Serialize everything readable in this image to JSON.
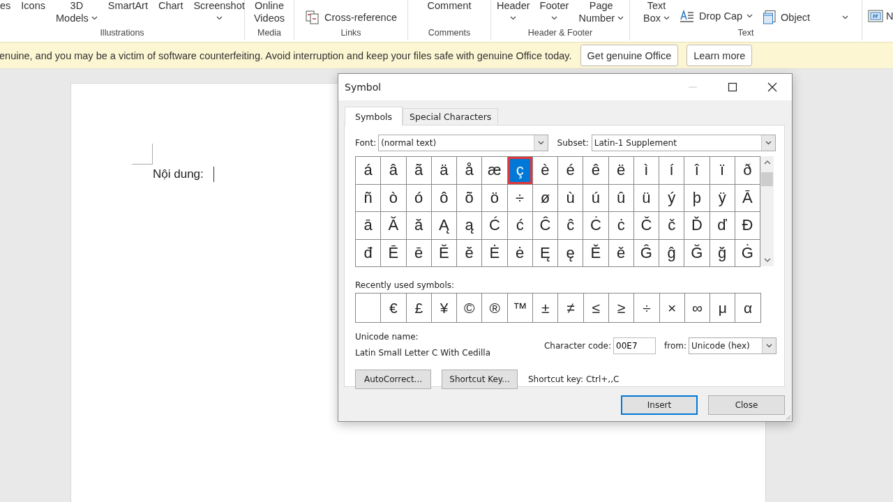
{
  "ribbon": {
    "groups": [
      {
        "label": "Illustrations",
        "items": [
          {
            "kind": "big",
            "lines": [
              "es"
            ],
            "dropdown": false
          },
          {
            "kind": "big",
            "lines": [
              "Icons"
            ],
            "dropdown": false
          },
          {
            "kind": "big",
            "lines": [
              "3D",
              "Models"
            ],
            "dropdown": true,
            "dropdown_below": false
          },
          {
            "kind": "big",
            "lines": [
              "SmartArt"
            ],
            "dropdown": false
          },
          {
            "kind": "big",
            "lines": [
              "Chart"
            ],
            "dropdown": false
          },
          {
            "kind": "big",
            "lines": [
              "Screenshot"
            ],
            "dropdown": true,
            "dropdown_below": true
          }
        ]
      },
      {
        "label": "Media",
        "items": [
          {
            "kind": "big",
            "lines": [
              "Online",
              "Videos"
            ],
            "dropdown": false
          }
        ]
      },
      {
        "label": "Links",
        "items": [
          {
            "kind": "small",
            "label": "Cross-reference",
            "dropdown": false
          }
        ]
      },
      {
        "label": "Comments",
        "items": [
          {
            "kind": "big",
            "lines": [
              "Comment"
            ],
            "dropdown": false
          }
        ]
      },
      {
        "label": "Header & Footer",
        "items": [
          {
            "kind": "big",
            "lines": [
              "Header"
            ],
            "dropdown": true,
            "dropdown_below": true
          },
          {
            "kind": "big",
            "lines": [
              "Footer"
            ],
            "dropdown": true,
            "dropdown_below": true
          },
          {
            "kind": "big",
            "lines": [
              "Page",
              "Number"
            ],
            "dropdown": true,
            "dropdown_below": false
          }
        ]
      },
      {
        "label": "Text",
        "items": [
          {
            "kind": "big",
            "lines": [
              "Text",
              "Box"
            ],
            "dropdown": true,
            "dropdown_below": false
          },
          {
            "kind": "small",
            "label": "Drop Cap",
            "dropdown": true,
            "split": false
          },
          {
            "kind": "small",
            "label": "Object",
            "dropdown": true,
            "split": true
          }
        ]
      },
      {
        "items": [
          {
            "kind": "small",
            "label": "N"
          }
        ]
      }
    ]
  },
  "notification": {
    "message": "enuine, and you may be a victim of software counterfeiting. Avoid interruption and keep your files safe with genuine Office today.",
    "buttons": [
      "Get genuine Office",
      "Learn more"
    ]
  },
  "document": {
    "text": "Nội dung:"
  },
  "dialog": {
    "title": "Symbol",
    "minimize_disabled": true,
    "tabs": [
      {
        "label": "Symbols",
        "selected": true
      },
      {
        "label": "Special Characters",
        "selected": false
      }
    ],
    "font": {
      "label": "Font:",
      "value": "(normal text)"
    },
    "subset": {
      "label": "Subset:",
      "value": "Latin-1 Supplement"
    },
    "grid": [
      [
        {
          "char": "á",
          "selected": false,
          "marked": false
        },
        {
          "char": "â",
          "selected": false,
          "marked": false
        },
        {
          "char": "ã",
          "selected": false,
          "marked": false
        },
        {
          "char": "ä",
          "selected": false,
          "marked": false
        },
        {
          "char": "å",
          "selected": false,
          "marked": false
        },
        {
          "char": "æ",
          "selected": false,
          "marked": false
        },
        {
          "char": "ç",
          "selected": true,
          "marked": true
        },
        {
          "char": "è",
          "selected": false,
          "marked": false
        },
        {
          "char": "é",
          "selected": false,
          "marked": false
        },
        {
          "char": "ê",
          "selected": false,
          "marked": false
        },
        {
          "char": "ë",
          "selected": false,
          "marked": false
        },
        {
          "char": "ì",
          "selected": false,
          "marked": false
        },
        {
          "char": "í",
          "selected": false,
          "marked": false
        },
        {
          "char": "î",
          "selected": false,
          "marked": false
        },
        {
          "char": "ï",
          "selected": false,
          "marked": false
        },
        {
          "char": "ð",
          "selected": false,
          "marked": false
        }
      ],
      [
        {
          "char": "ñ",
          "selected": false,
          "marked": false
        },
        {
          "char": "ò",
          "selected": false,
          "marked": false
        },
        {
          "char": "ó",
          "selected": false,
          "marked": false
        },
        {
          "char": "ô",
          "selected": false,
          "marked": false
        },
        {
          "char": "õ",
          "selected": false,
          "marked": false
        },
        {
          "char": "ö",
          "selected": false,
          "marked": false
        },
        {
          "char": "÷",
          "selected": false,
          "marked": false
        },
        {
          "char": "ø",
          "selected": false,
          "marked": false
        },
        {
          "char": "ù",
          "selected": false,
          "marked": false
        },
        {
          "char": "ú",
          "selected": false,
          "marked": false
        },
        {
          "char": "û",
          "selected": false,
          "marked": false
        },
        {
          "char": "ü",
          "selected": false,
          "marked": false
        },
        {
          "char": "ý",
          "selected": false,
          "marked": false
        },
        {
          "char": "þ",
          "selected": false,
          "marked": false
        },
        {
          "char": "ÿ",
          "selected": false,
          "marked": false
        },
        {
          "char": "Ā",
          "selected": false,
          "marked": false
        }
      ],
      [
        {
          "char": "ā",
          "selected": false,
          "marked": false
        },
        {
          "char": "Ă",
          "selected": false,
          "marked": false
        },
        {
          "char": "ă",
          "selected": false,
          "marked": false
        },
        {
          "char": "Ą",
          "selected": false,
          "marked": false
        },
        {
          "char": "ą",
          "selected": false,
          "marked": false
        },
        {
          "char": "Ć",
          "selected": false,
          "marked": false
        },
        {
          "char": "ć",
          "selected": false,
          "marked": false
        },
        {
          "char": "Ĉ",
          "selected": false,
          "marked": false
        },
        {
          "char": "ĉ",
          "selected": false,
          "marked": false
        },
        {
          "char": "Ċ",
          "selected": false,
          "marked": false
        },
        {
          "char": "ċ",
          "selected": false,
          "marked": false
        },
        {
          "char": "Č",
          "selected": false,
          "marked": false
        },
        {
          "char": "č",
          "selected": false,
          "marked": false
        },
        {
          "char": "Ď",
          "selected": false,
          "marked": false
        },
        {
          "char": "ď",
          "selected": false,
          "marked": false
        },
        {
          "char": "Đ",
          "selected": false,
          "marked": false
        }
      ],
      [
        {
          "char": "đ",
          "selected": false,
          "marked": false
        },
        {
          "char": "Ē",
          "selected": false,
          "marked": false
        },
        {
          "char": "ē",
          "selected": false,
          "marked": false
        },
        {
          "char": "Ĕ",
          "selected": false,
          "marked": false
        },
        {
          "char": "ĕ",
          "selected": false,
          "marked": false
        },
        {
          "char": "Ė",
          "selected": false,
          "marked": false
        },
        {
          "char": "ė",
          "selected": false,
          "marked": false
        },
        {
          "char": "Ę",
          "selected": false,
          "marked": false
        },
        {
          "char": "ę",
          "selected": false,
          "marked": false
        },
        {
          "char": "Ě",
          "selected": false,
          "marked": false
        },
        {
          "char": "ě",
          "selected": false,
          "marked": false
        },
        {
          "char": "Ĝ",
          "selected": false,
          "marked": false
        },
        {
          "char": "ĝ",
          "selected": false,
          "marked": false
        },
        {
          "char": "Ğ",
          "selected": false,
          "marked": false
        },
        {
          "char": "ğ",
          "selected": false,
          "marked": false
        },
        {
          "char": "Ġ",
          "selected": false,
          "marked": false
        }
      ]
    ],
    "recent_label": "Recently used symbols:",
    "recent": [
      {
        "kind": "blank"
      },
      {
        "kind": "symbol",
        "symbol": "€"
      },
      {
        "kind": "symbol",
        "symbol": "£"
      },
      {
        "kind": "symbol",
        "symbol": "¥"
      },
      {
        "kind": "symbol",
        "symbol": "©"
      },
      {
        "kind": "symbol",
        "symbol": "®"
      },
      {
        "kind": "symbol",
        "symbol": "™"
      },
      {
        "kind": "symbol",
        "symbol": "±"
      },
      {
        "kind": "symbol",
        "symbol": "≠"
      },
      {
        "kind": "symbol",
        "symbol": "≤"
      },
      {
        "kind": "symbol",
        "symbol": "≥"
      },
      {
        "kind": "symbol",
        "symbol": "÷"
      },
      {
        "kind": "symbol",
        "symbol": "×"
      },
      {
        "kind": "symbol",
        "symbol": "∞"
      },
      {
        "kind": "symbol",
        "symbol": "μ"
      },
      {
        "kind": "symbol",
        "symbol": "α"
      }
    ],
    "unicode_name_label": "Unicode name:",
    "unicode_name": "Latin Small Letter C With Cedilla",
    "character_code": {
      "label": "Character code:",
      "value": "00E7"
    },
    "from": {
      "label": "from:",
      "value": "Unicode (hex)"
    },
    "actions": [
      "AutoCorrect...",
      "Shortcut Key..."
    ],
    "shortcut_text": "Shortcut key: Ctrl+,,C",
    "buttons": [
      {
        "label": "Insert",
        "default": true
      },
      {
        "label": "Close",
        "default": false
      }
    ]
  }
}
